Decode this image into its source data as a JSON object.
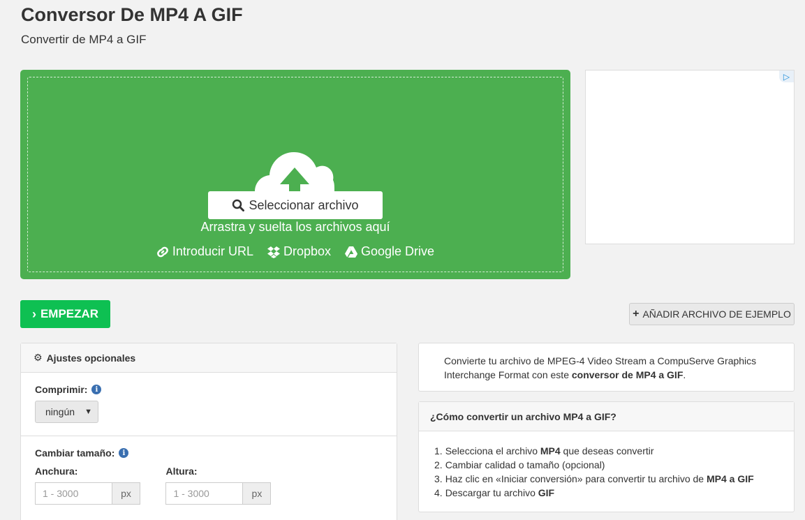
{
  "page": {
    "title": "Conversor De MP4 A GIF",
    "subtitle": "Convertir de MP4 a GIF"
  },
  "dropzone": {
    "drop_text": "Arrastra y suelta los archivos aquí",
    "select_label": "Seleccionar archivo",
    "sources": [
      {
        "label": "Introducir URL",
        "icon": "link-icon"
      },
      {
        "label": "Dropbox",
        "icon": "dropbox-icon"
      },
      {
        "label": "Google Drive",
        "icon": "google-drive-icon"
      }
    ],
    "bg_color": "#4caf50"
  },
  "actions": {
    "start_label": "EMPEZAR",
    "sample_label": "AÑADIR ARCHIVO DE EJEMPLO",
    "start_color": "#0ec052"
  },
  "options": {
    "heading": "Ajustes opcionales",
    "compress": {
      "label": "Comprimir:",
      "selected": "ningún"
    },
    "resize": {
      "label": "Cambiar tamaño:",
      "width_label": "Anchura:",
      "height_label": "Altura:",
      "width_placeholder": "1 - 3000",
      "height_placeholder": "1 - 3000",
      "unit": "px"
    }
  },
  "description": {
    "text_prefix": "Convierte tu archivo de MPEG-4 Video Stream a CompuServe Graphics Interchange Format con este ",
    "text_bold": "conversor de MP4 a GIF",
    "text_suffix": "."
  },
  "howto": {
    "heading": "¿Cómo convertir un archivo MP4 a GIF?",
    "steps": [
      {
        "num": "1.",
        "pre": "Selecciona el archivo ",
        "bold": "MP4",
        "post": " que deseas convertir"
      },
      {
        "num": "2.",
        "pre": "Cambiar calidad o tamaño (opcional)",
        "bold": "",
        "post": ""
      },
      {
        "num": "3.",
        "pre": "Haz clic en «Iniciar conversión» para convertir tu archivo de ",
        "bold": "MP4 a GIF",
        "post": ""
      },
      {
        "num": "4.",
        "pre": "Descargar tu archivo ",
        "bold": "GIF",
        "post": ""
      }
    ]
  }
}
